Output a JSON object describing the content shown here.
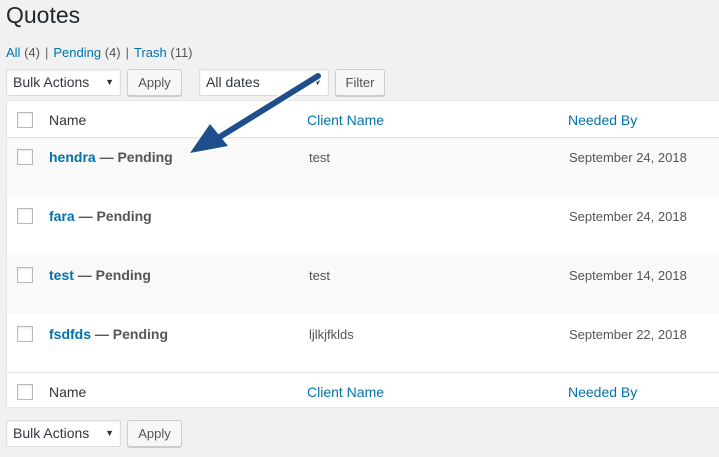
{
  "page": {
    "title": "Quotes"
  },
  "filters": [
    {
      "label": "All",
      "count": "(4)"
    },
    {
      "label": "Pending",
      "count": "(4)"
    },
    {
      "label": "Trash",
      "count": "(11)"
    }
  ],
  "top_actions": {
    "bulk_actions": "Bulk Actions",
    "apply": "Apply",
    "dates": "All dates",
    "filter": "Filter"
  },
  "bottom_actions": {
    "bulk_actions": "Bulk Actions",
    "apply": "Apply"
  },
  "columns": {
    "name": "Name",
    "client": "Client Name",
    "needed": "Needed By"
  },
  "rows": [
    {
      "name": "hendra",
      "status": "— Pending",
      "client": "test",
      "needed": "September 24, 2018"
    },
    {
      "name": "fara",
      "status": "— Pending",
      "client": "",
      "needed": "September 24, 2018"
    },
    {
      "name": "test",
      "status": "— Pending",
      "client": "test",
      "needed": "September 14, 2018"
    },
    {
      "name": "fsdfds",
      "status": "— Pending",
      "client": "ljlkjfklds",
      "needed": "September 22, 2018"
    }
  ],
  "colors": {
    "link": "#0073aa",
    "arrow": "#1f4e8c"
  }
}
